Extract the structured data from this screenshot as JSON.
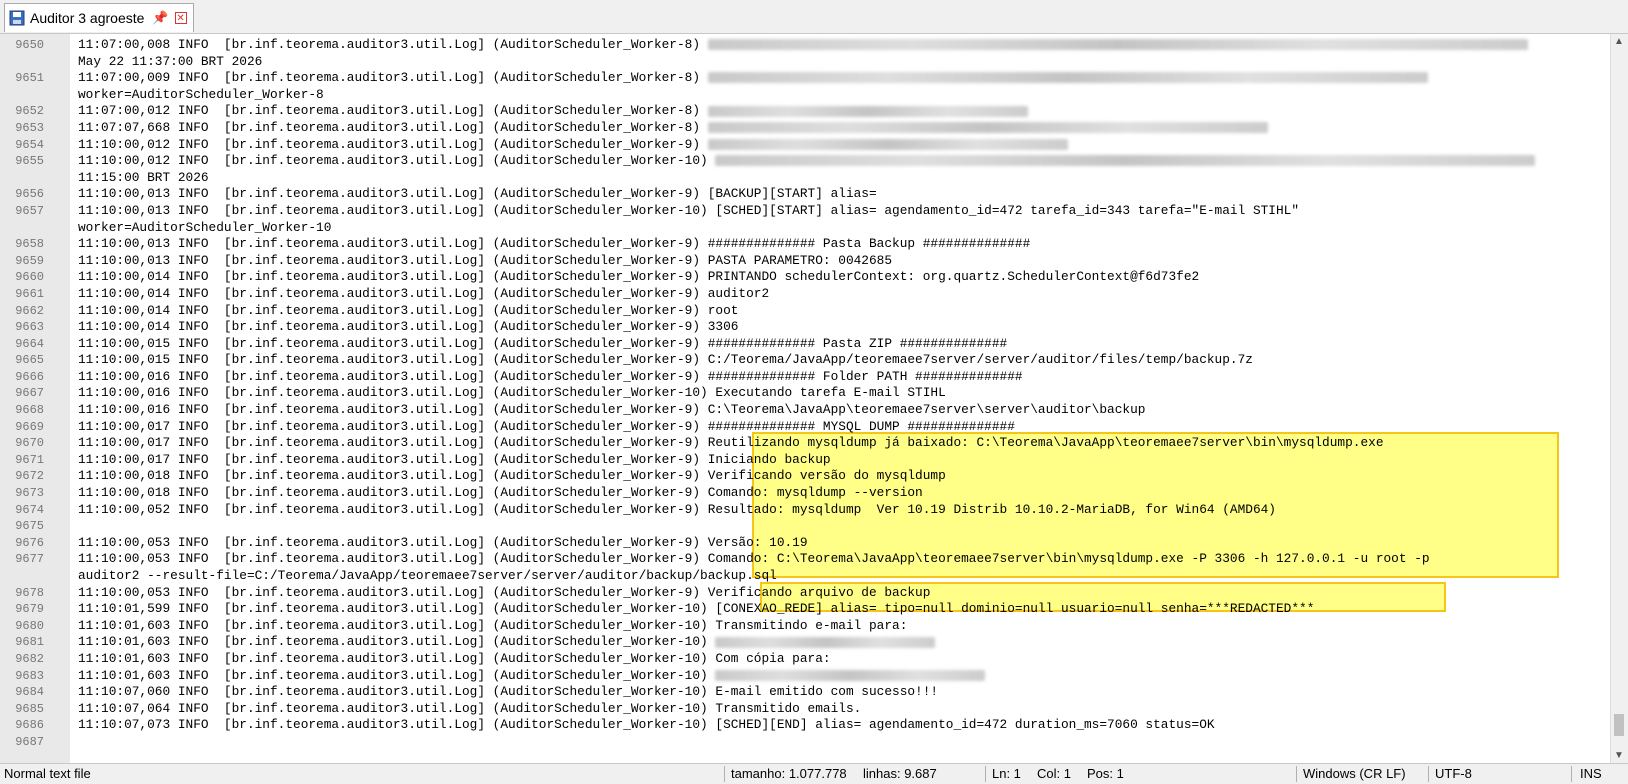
{
  "tab": {
    "title": "Auditor 3 agroeste",
    "pin": "📌",
    "close": "✕"
  },
  "lines": [
    {
      "n": "9650",
      "t": "11:07:00,008 INFO  [br.inf.teorema.auditor3.util.Log] (AuditorScheduler_Worker-8) ",
      "blur": 820
    },
    {
      "n": "",
      "t": "May 22 11:37:00 BRT 2026"
    },
    {
      "n": "9651",
      "t": "11:07:00,009 INFO  [br.inf.teorema.auditor3.util.Log] (AuditorScheduler_Worker-8) ",
      "blur": 720
    },
    {
      "n": "",
      "t": "worker=AuditorScheduler_Worker-8"
    },
    {
      "n": "9652",
      "t": "11:07:00,012 INFO  [br.inf.teorema.auditor3.util.Log] (AuditorScheduler_Worker-8) ",
      "blur": 320
    },
    {
      "n": "9653",
      "t": "11:07:07,668 INFO  [br.inf.teorema.auditor3.util.Log] (AuditorScheduler_Worker-8) ",
      "blur": 560
    },
    {
      "n": "9654",
      "t": "11:10:00,012 INFO  [br.inf.teorema.auditor3.util.Log] (AuditorScheduler_Worker-9) ",
      "blur": 360
    },
    {
      "n": "9655",
      "t": "11:10:00,012 INFO  [br.inf.teorema.auditor3.util.Log] (AuditorScheduler_Worker-10) ",
      "blur": 820
    },
    {
      "n": "",
      "t": "11:15:00 BRT 2026"
    },
    {
      "n": "9656",
      "t": "11:10:00,013 INFO  [br.inf.teorema.auditor3.util.Log] (AuditorScheduler_Worker-9) [BACKUP][START] alias="
    },
    {
      "n": "9657",
      "t": "11:10:00,013 INFO  [br.inf.teorema.auditor3.util.Log] (AuditorScheduler_Worker-10) [SCHED][START] alias= agendamento_id=472 tarefa_id=343 tarefa=\"E-mail STIHL\""
    },
    {
      "n": "",
      "t": "worker=AuditorScheduler_Worker-10"
    },
    {
      "n": "9658",
      "t": "11:10:00,013 INFO  [br.inf.teorema.auditor3.util.Log] (AuditorScheduler_Worker-9) ############## Pasta Backup ##############"
    },
    {
      "n": "9659",
      "t": "11:10:00,013 INFO  [br.inf.teorema.auditor3.util.Log] (AuditorScheduler_Worker-9) PASTA PARAMETRO: 0042685"
    },
    {
      "n": "9660",
      "t": "11:10:00,014 INFO  [br.inf.teorema.auditor3.util.Log] (AuditorScheduler_Worker-9) PRINTANDO schedulerContext: org.quartz.SchedulerContext@f6d73fe2"
    },
    {
      "n": "9661",
      "t": "11:10:00,014 INFO  [br.inf.teorema.auditor3.util.Log] (AuditorScheduler_Worker-9) auditor2"
    },
    {
      "n": "9662",
      "t": "11:10:00,014 INFO  [br.inf.teorema.auditor3.util.Log] (AuditorScheduler_Worker-9) root"
    },
    {
      "n": "9663",
      "t": "11:10:00,014 INFO  [br.inf.teorema.auditor3.util.Log] (AuditorScheduler_Worker-9) 3306"
    },
    {
      "n": "9664",
      "t": "11:10:00,015 INFO  [br.inf.teorema.auditor3.util.Log] (AuditorScheduler_Worker-9) ############## Pasta ZIP ##############"
    },
    {
      "n": "9665",
      "t": "11:10:00,015 INFO  [br.inf.teorema.auditor3.util.Log] (AuditorScheduler_Worker-9) C:/Teorema/JavaApp/teoremaee7server/server/auditor/files/temp/backup.7z"
    },
    {
      "n": "9666",
      "t": "11:10:00,016 INFO  [br.inf.teorema.auditor3.util.Log] (AuditorScheduler_Worker-9) ############## Folder PATH ##############"
    },
    {
      "n": "9667",
      "t": "11:10:00,016 INFO  [br.inf.teorema.auditor3.util.Log] (AuditorScheduler_Worker-10) Executando tarefa E-mail STIHL"
    },
    {
      "n": "9668",
      "t": "11:10:00,016 INFO  [br.inf.teorema.auditor3.util.Log] (AuditorScheduler_Worker-9) C:\\Teorema\\JavaApp\\teoremaee7server\\server\\auditor\\backup"
    },
    {
      "n": "9669",
      "t": "11:10:00,017 INFO  [br.inf.teorema.auditor3.util.Log] (AuditorScheduler_Worker-9) ############## MYSQL DUMP ##############"
    },
    {
      "n": "9670",
      "t": "11:10:00,017 INFO  [br.inf.teorema.auditor3.util.Log] (AuditorScheduler_Worker-9) Reutilizando mysqldump já baixado: C:\\Teorema\\JavaApp\\teoremaee7server\\bin\\mysqldump.exe"
    },
    {
      "n": "9671",
      "t": "11:10:00,017 INFO  [br.inf.teorema.auditor3.util.Log] (AuditorScheduler_Worker-9) Iniciando backup"
    },
    {
      "n": "9672",
      "t": "11:10:00,018 INFO  [br.inf.teorema.auditor3.util.Log] (AuditorScheduler_Worker-9) Verificando versão do mysqldump"
    },
    {
      "n": "9673",
      "t": "11:10:00,018 INFO  [br.inf.teorema.auditor3.util.Log] (AuditorScheduler_Worker-9) Comando: mysqldump --version"
    },
    {
      "n": "9674",
      "t": "11:10:00,052 INFO  [br.inf.teorema.auditor3.util.Log] (AuditorScheduler_Worker-9) Resultado: mysqldump  Ver 10.19 Distrib 10.10.2-MariaDB, for Win64 (AMD64)"
    },
    {
      "n": "9675",
      "t": ""
    },
    {
      "n": "9676",
      "t": "11:10:00,053 INFO  [br.inf.teorema.auditor3.util.Log] (AuditorScheduler_Worker-9) Versão: 10.19"
    },
    {
      "n": "9677",
      "t": "11:10:00,053 INFO  [br.inf.teorema.auditor3.util.Log] (AuditorScheduler_Worker-9) Comando: C:\\Teorema\\JavaApp\\teoremaee7server\\bin\\mysqldump.exe -P 3306 -h 127.0.0.1 -u root -p"
    },
    {
      "n": "",
      "t": "auditor2 --result-file=C:/Teorema/JavaApp/teoremaee7server/server/auditor/backup/backup.sql"
    },
    {
      "n": "9678",
      "t": "11:10:00,053 INFO  [br.inf.teorema.auditor3.util.Log] (AuditorScheduler_Worker-9) Verificando arquivo de backup"
    },
    {
      "n": "9679",
      "t": "11:10:01,599 INFO  [br.inf.teorema.auditor3.util.Log] (AuditorScheduler_Worker-10) [CONEXAO_REDE] alias= tipo=null dominio=null usuario=null senha=***REDACTED***"
    },
    {
      "n": "9680",
      "t": "11:10:01,603 INFO  [br.inf.teorema.auditor3.util.Log] (AuditorScheduler_Worker-10) Transmitindo e-mail para:"
    },
    {
      "n": "9681",
      "t": "11:10:01,603 INFO  [br.inf.teorema.auditor3.util.Log] (AuditorScheduler_Worker-10) ",
      "blur": 220
    },
    {
      "n": "9682",
      "t": "11:10:01,603 INFO  [br.inf.teorema.auditor3.util.Log] (AuditorScheduler_Worker-10) Com cópia para:"
    },
    {
      "n": "9683",
      "t": "11:10:01,603 INFO  [br.inf.teorema.auditor3.util.Log] (AuditorScheduler_Worker-10) ",
      "blur": 270
    },
    {
      "n": "9684",
      "t": "11:10:07,060 INFO  [br.inf.teorema.auditor3.util.Log] (AuditorScheduler_Worker-10) E-mail emitido com sucesso!!!"
    },
    {
      "n": "9685",
      "t": "11:10:07,064 INFO  [br.inf.teorema.auditor3.util.Log] (AuditorScheduler_Worker-10) Transmitido emails."
    },
    {
      "n": "9686",
      "t": "11:10:07,073 INFO  [br.inf.teorema.auditor3.util.Log] (AuditorScheduler_Worker-10) [SCHED][END] alias= agendamento_id=472 duration_ms=7060 status=OK"
    },
    {
      "n": "9687",
      "t": ""
    }
  ],
  "status": {
    "type": "Normal text file",
    "size": "tamanho: 1.077.778",
    "lines": "linhas: 9.687",
    "ln": "Ln: 1",
    "col": "Col: 1",
    "pos": "Pos: 1",
    "eol": "Windows (CR LF)",
    "encoding": "UTF-8",
    "mode": "INS"
  }
}
